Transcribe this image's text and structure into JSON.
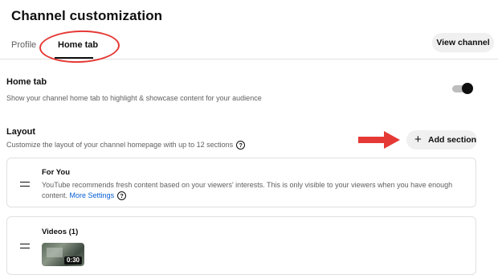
{
  "page": {
    "title": "Channel customization"
  },
  "tabs": [
    {
      "label": "Profile",
      "active": false
    },
    {
      "label": "Home tab",
      "active": true
    }
  ],
  "header": {
    "view_channel_label": "View channel"
  },
  "home_tab_setting": {
    "title": "Home tab",
    "description": "Show your channel home tab to highlight & showcase content for your audience",
    "toggle_on": true
  },
  "layout": {
    "title": "Layout",
    "description": "Customize the layout of your channel homepage with up to 12 sections",
    "help_glyph": "?",
    "add_section_label": "Add section",
    "add_icon_glyph": "+"
  },
  "sections": [
    {
      "title": "For You",
      "description": "YouTube recommends fresh content based on your viewers' interests. This is only visible to your viewers when you have enough content.",
      "link_label": "More Settings",
      "help_glyph": "?"
    },
    {
      "title": "Videos (1)",
      "thumbnail": {
        "duration": "0:30"
      }
    }
  ],
  "colors": {
    "annotation_red": "#e53935",
    "link_blue": "#065fd4",
    "toggle_knob": "#0f0f0f"
  },
  "icons": {
    "help": "help-icon",
    "plus": "plus-icon",
    "drag": "drag-handle-icon",
    "annotation_arrow": "arrow-right-icon",
    "annotation_circle": "ellipse-annotation"
  }
}
